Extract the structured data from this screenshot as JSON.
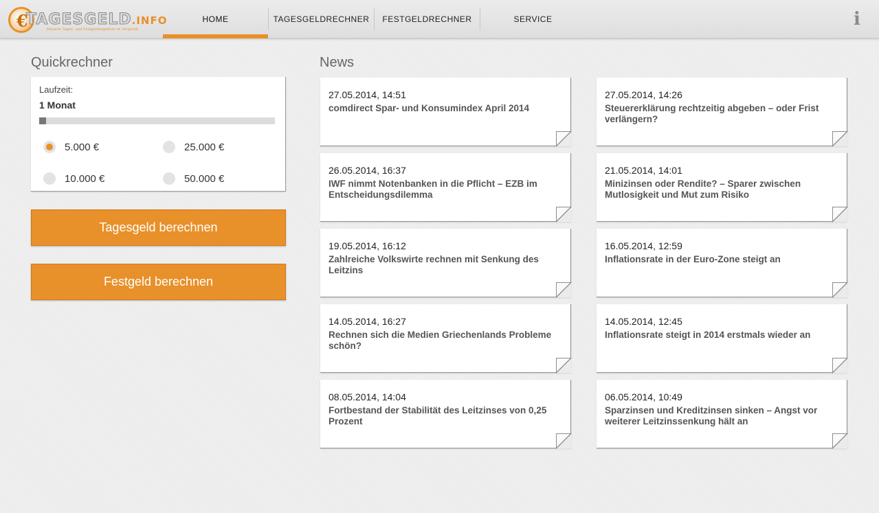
{
  "header": {
    "logo": {
      "text_main": "TAGESGELD",
      "text_ext": ".INFO",
      "tagline": "Aktuelle Tages- und Festgeldangebote im Vergleich",
      "accent": "#e8902a"
    },
    "nav": [
      {
        "label": "HOME",
        "active": true
      },
      {
        "label": "TAGESGELDRECHNER",
        "active": false
      },
      {
        "label": "FESTGELDRECHNER",
        "active": false
      },
      {
        "label": "SERVICE",
        "active": false
      }
    ],
    "info_icon": "info-icon"
  },
  "quickrechner": {
    "title": "Quickrechner",
    "laufzeit_label": "Laufzeit:",
    "laufzeit_value": "1 Monat",
    "slider_fraction": 0.0,
    "amounts": [
      {
        "label": "5.000 €",
        "selected": true
      },
      {
        "label": "25.000 €",
        "selected": false
      },
      {
        "label": "10.000 €",
        "selected": false
      },
      {
        "label": "50.000 €",
        "selected": false
      }
    ],
    "buttons": {
      "tagesgeld": "Tagesgeld berechnen",
      "festgeld": "Festgeld berechnen"
    }
  },
  "news": {
    "title": "News",
    "items": [
      {
        "date": "27.05.2014, 14:51",
        "title": "comdirect Spar- und Konsumindex April 2014"
      },
      {
        "date": "27.05.2014, 14:26",
        "title": "Steuererklärung rechtzeitig abgeben – oder Frist verlängern?"
      },
      {
        "date": "26.05.2014, 16:37",
        "title": "IWF nimmt Notenbanken in die Pflicht – EZB im Entscheidungsdilemma"
      },
      {
        "date": "21.05.2014, 14:01",
        "title": "Minizinsen oder Rendite? – Sparer zwischen Mutlosigkeit und Mut zum Risiko"
      },
      {
        "date": "19.05.2014, 16:12",
        "title": "Zahlreiche Volkswirte rechnen mit Senkung des Leitzins"
      },
      {
        "date": "16.05.2014, 12:59",
        "title": "Inflationsrate in der Euro-Zone steigt an"
      },
      {
        "date": "14.05.2014, 16:27",
        "title": "Rechnen sich die Medien Griechenlands Probleme schön?"
      },
      {
        "date": "14.05.2014, 12:45",
        "title": "Inflationsrate steigt in 2014 erstmals wieder an"
      },
      {
        "date": "08.05.2014, 14:04",
        "title": "Fortbestand der Stabilität des Leitzinses von 0,25 Prozent"
      },
      {
        "date": "06.05.2014, 10:49",
        "title": "Sparzinsen und Kreditzinsen sinken – Angst vor weiterer Leitzinssenkung hält an"
      }
    ]
  }
}
